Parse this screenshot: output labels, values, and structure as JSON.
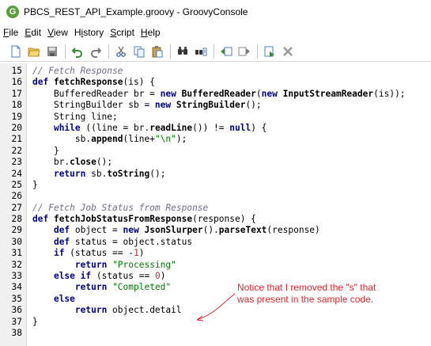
{
  "window": {
    "app_icon_letter": "G",
    "title": "PBCS_REST_API_Example.groovy - GroovyConsole"
  },
  "menu": [
    {
      "pre": "",
      "u": "F",
      "post": "ile"
    },
    {
      "pre": "",
      "u": "E",
      "post": "dit"
    },
    {
      "pre": "",
      "u": "V",
      "post": "iew"
    },
    {
      "pre": "H",
      "u": "i",
      "post": "story"
    },
    {
      "pre": "",
      "u": "S",
      "post": "cript"
    },
    {
      "pre": "",
      "u": "H",
      "post": "elp"
    }
  ],
  "toolbar": {
    "icons": [
      "new-file-icon",
      "open-folder-icon",
      "save-icon",
      "undo-icon",
      "redo-icon",
      "cut-icon",
      "copy-icon",
      "paste-icon",
      "find-icon",
      "replace-icon",
      "history-previous-icon",
      "history-next-icon",
      "run-script-icon",
      "interrupt-icon"
    ]
  },
  "editor": {
    "lines": [
      {
        "n": "15",
        "tokens": [
          {
            "t": "// Fetch Response",
            "c": "cm"
          }
        ]
      },
      {
        "n": "16",
        "tokens": [
          {
            "t": "def ",
            "c": "kw"
          },
          {
            "t": "fetchResponse",
            "c": "mt"
          },
          {
            "t": "(is) {",
            "c": ""
          }
        ]
      },
      {
        "n": "17",
        "tokens": [
          {
            "t": "    BufferedReader br = ",
            "c": ""
          },
          {
            "t": "new ",
            "c": "kw"
          },
          {
            "t": "BufferedReader",
            "c": "mt"
          },
          {
            "t": "(",
            "c": ""
          },
          {
            "t": "new ",
            "c": "kw"
          },
          {
            "t": "InputStreamReader",
            "c": "mt"
          },
          {
            "t": "(is));",
            "c": ""
          }
        ]
      },
      {
        "n": "18",
        "tokens": [
          {
            "t": "    StringBuilder sb = ",
            "c": ""
          },
          {
            "t": "new ",
            "c": "kw"
          },
          {
            "t": "StringBuilder",
            "c": "mt"
          },
          {
            "t": "();",
            "c": ""
          }
        ]
      },
      {
        "n": "19",
        "tokens": [
          {
            "t": "    String line;",
            "c": ""
          }
        ]
      },
      {
        "n": "20",
        "tokens": [
          {
            "t": "    ",
            "c": ""
          },
          {
            "t": "while",
            "c": "kw"
          },
          {
            "t": " ((line = br.",
            "c": ""
          },
          {
            "t": "readLine",
            "c": "mt"
          },
          {
            "t": "()) != ",
            "c": ""
          },
          {
            "t": "null",
            "c": "kw"
          },
          {
            "t": ") {",
            "c": ""
          }
        ]
      },
      {
        "n": "21",
        "tokens": [
          {
            "t": "        sb.",
            "c": ""
          },
          {
            "t": "append",
            "c": "mt"
          },
          {
            "t": "(line+",
            "c": ""
          },
          {
            "t": "\"\\n\"",
            "c": "st"
          },
          {
            "t": ");",
            "c": ""
          }
        ]
      },
      {
        "n": "22",
        "tokens": [
          {
            "t": "    }",
            "c": ""
          }
        ]
      },
      {
        "n": "23",
        "tokens": [
          {
            "t": "    br.",
            "c": ""
          },
          {
            "t": "close",
            "c": "mt"
          },
          {
            "t": "();",
            "c": ""
          }
        ]
      },
      {
        "n": "24",
        "tokens": [
          {
            "t": "    ",
            "c": ""
          },
          {
            "t": "return",
            "c": "kw"
          },
          {
            "t": " sb.",
            "c": ""
          },
          {
            "t": "toString",
            "c": "mt"
          },
          {
            "t": "();",
            "c": ""
          }
        ]
      },
      {
        "n": "25",
        "tokens": [
          {
            "t": "}",
            "c": ""
          }
        ]
      },
      {
        "n": "26",
        "tokens": []
      },
      {
        "n": "27",
        "tokens": [
          {
            "t": "// Fetch Job Status from Response",
            "c": "cm"
          }
        ]
      },
      {
        "n": "28",
        "tokens": [
          {
            "t": "def ",
            "c": "kw"
          },
          {
            "t": "fetchJobStatusFromResponse",
            "c": "mt"
          },
          {
            "t": "(response) {",
            "c": ""
          }
        ]
      },
      {
        "n": "29",
        "tokens": [
          {
            "t": "    ",
            "c": ""
          },
          {
            "t": "def",
            "c": "kw"
          },
          {
            "t": " object = ",
            "c": ""
          },
          {
            "t": "new ",
            "c": "kw"
          },
          {
            "t": "JsonSlurper",
            "c": "mt"
          },
          {
            "t": "().",
            "c": ""
          },
          {
            "t": "parseText",
            "c": "mt"
          },
          {
            "t": "(response)",
            "c": ""
          }
        ]
      },
      {
        "n": "30",
        "tokens": [
          {
            "t": "    ",
            "c": ""
          },
          {
            "t": "def",
            "c": "kw"
          },
          {
            "t": " status = object.status",
            "c": ""
          }
        ]
      },
      {
        "n": "31",
        "tokens": [
          {
            "t": "    ",
            "c": ""
          },
          {
            "t": "if",
            "c": "kw"
          },
          {
            "t": " (status == -",
            "c": ""
          },
          {
            "t": "1",
            "c": "num"
          },
          {
            "t": ")",
            "c": ""
          }
        ]
      },
      {
        "n": "32",
        "tokens": [
          {
            "t": "        ",
            "c": ""
          },
          {
            "t": "return",
            "c": "kw"
          },
          {
            "t": " ",
            "c": ""
          },
          {
            "t": "\"Processing\"",
            "c": "st"
          }
        ]
      },
      {
        "n": "33",
        "tokens": [
          {
            "t": "    ",
            "c": ""
          },
          {
            "t": "else if",
            "c": "kw"
          },
          {
            "t": " (status == ",
            "c": ""
          },
          {
            "t": "0",
            "c": "num"
          },
          {
            "t": ")",
            "c": ""
          }
        ]
      },
      {
        "n": "34",
        "tokens": [
          {
            "t": "        ",
            "c": ""
          },
          {
            "t": "return",
            "c": "kw"
          },
          {
            "t": " ",
            "c": ""
          },
          {
            "t": "\"Completed\"",
            "c": "st"
          }
        ]
      },
      {
        "n": "35",
        "tokens": [
          {
            "t": "    ",
            "c": ""
          },
          {
            "t": "else",
            "c": "kw"
          }
        ]
      },
      {
        "n": "36",
        "tokens": [
          {
            "t": "        ",
            "c": ""
          },
          {
            "t": "return",
            "c": "kw"
          },
          {
            "t": " object.detail",
            "c": ""
          }
        ]
      },
      {
        "n": "37",
        "tokens": [
          {
            "t": "}",
            "c": ""
          }
        ]
      },
      {
        "n": "38",
        "tokens": []
      }
    ]
  },
  "annotation": {
    "line1": "Notice that I removed the \"s\" that",
    "line2": "was present in the sample code.",
    "color": "#e8262d"
  }
}
